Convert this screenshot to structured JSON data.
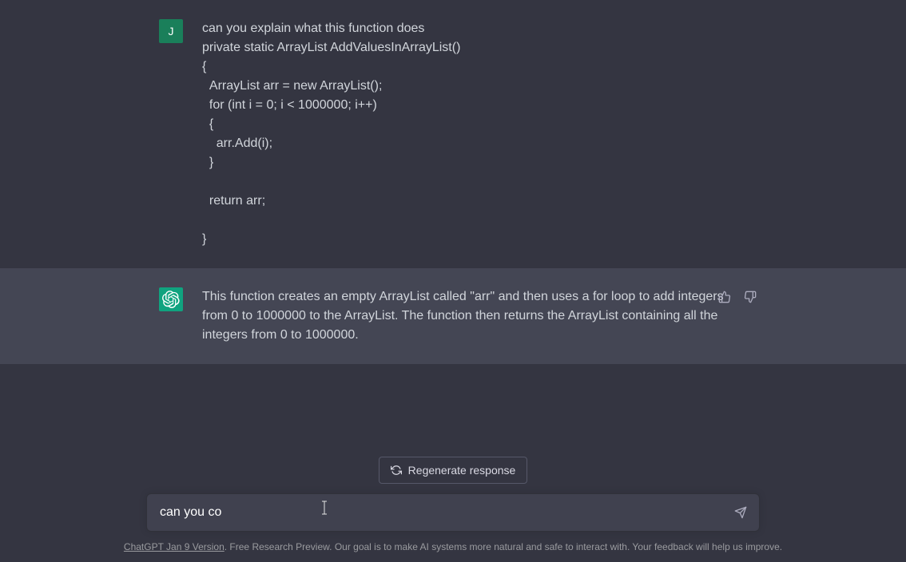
{
  "conversation": {
    "user_avatar_letter": "J",
    "user_message": "can you explain what this function does\nprivate static ArrayList AddValuesInArrayList()\n{\n  ArrayList arr = new ArrayList();\n  for (int i = 0; i < 1000000; i++)\n  {\n    arr.Add(i);\n  }\n\n  return arr;\n\n}",
    "assistant_message": "This function creates an empty ArrayList called \"arr\" and then uses a for loop to add integers from 0 to 1000000 to the ArrayList. The function then returns the ArrayList containing all the integers from 0 to 1000000."
  },
  "controls": {
    "regenerate_label": "Regenerate response"
  },
  "input": {
    "value": "can you co",
    "placeholder": ""
  },
  "footer": {
    "link_text": "ChatGPT Jan 9 Version",
    "rest_text": ". Free Research Preview. Our goal is to make AI systems more natural and safe to interact with. Your feedback will help us improve."
  }
}
